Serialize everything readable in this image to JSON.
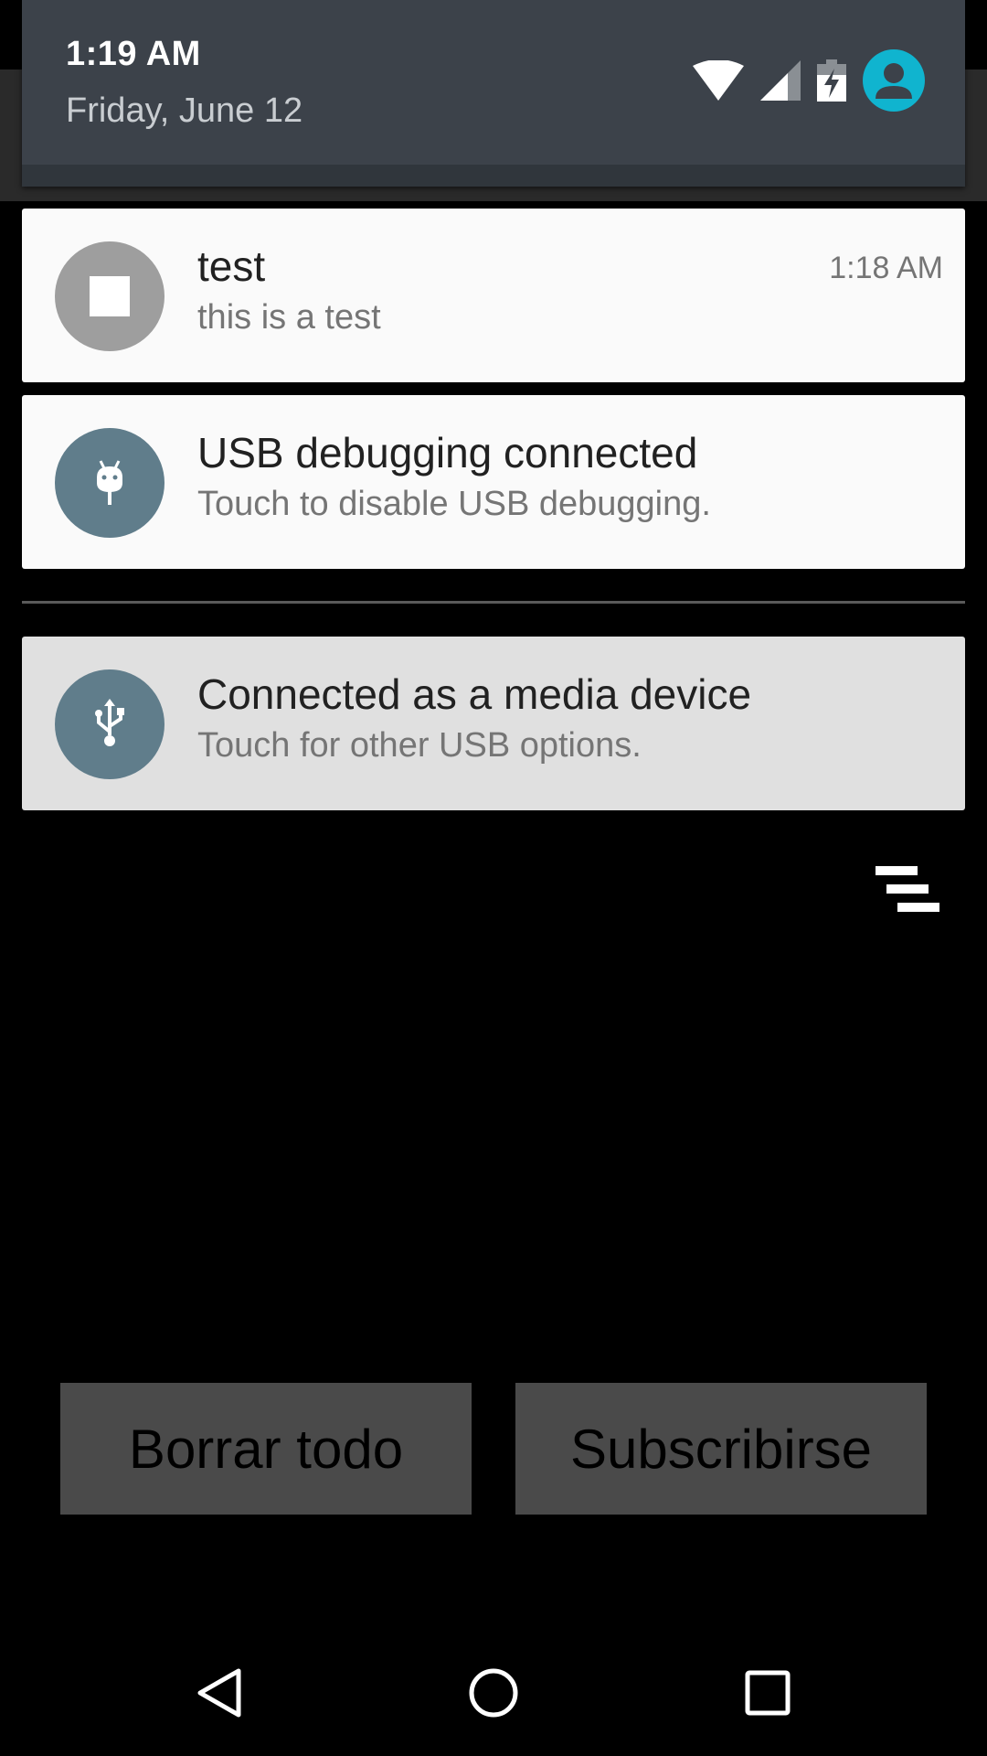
{
  "quick_header": {
    "time": "1:19 AM",
    "date": "Friday, June 12",
    "icons": [
      "wifi-icon",
      "signal-icon",
      "battery-charging-icon",
      "user-avatar-icon"
    ]
  },
  "notifications": [
    {
      "title": "test",
      "text": "this is a test",
      "time": "1:18 AM",
      "icon": "stop-icon",
      "icon_bg": "#9e9e9e"
    },
    {
      "title": "USB debugging connected",
      "text": "Touch to disable USB debugging.",
      "icon": "android-debug-icon",
      "icon_bg": "#607d8b"
    },
    {
      "title": "Connected as a media device",
      "text": "Touch for other USB options.",
      "icon": "usb-icon",
      "icon_bg": "#607d8b"
    }
  ],
  "actions": {
    "dismiss_all_icon": "clear-all-icon"
  },
  "app_buttons": {
    "clear_all": "Borrar todo",
    "subscribe": "Subscribirse"
  },
  "nav": {
    "back": "back-icon",
    "home": "home-icon",
    "recents": "recents-icon"
  },
  "colors": {
    "header_bg": "#3c424a",
    "avatar": "#10b4cf",
    "notification_bg": "#fafafa",
    "notification_pressed_bg": "#e0e0e0",
    "app_button_bg": "#4a4a4a"
  }
}
